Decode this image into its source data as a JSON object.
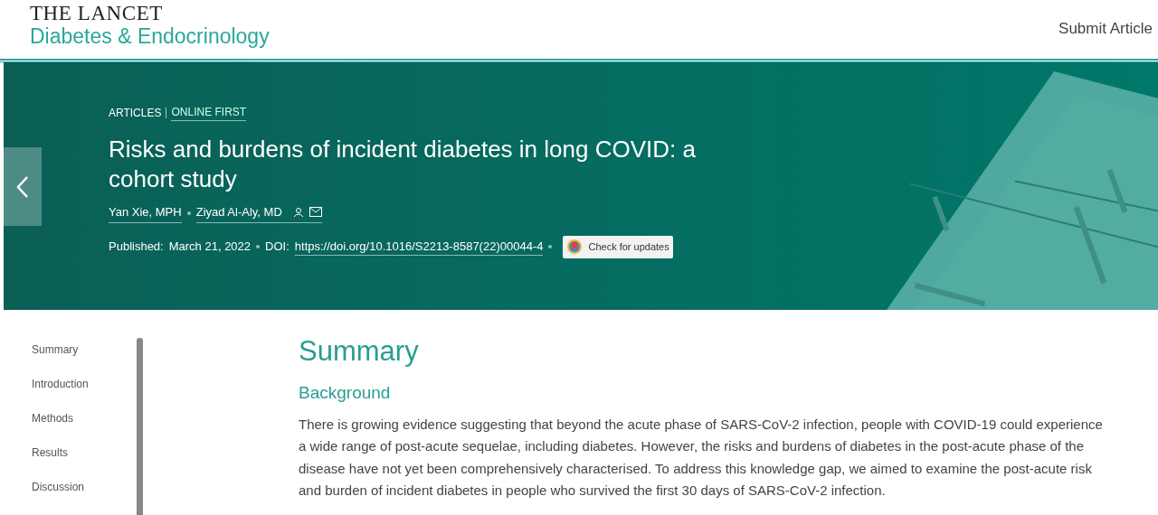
{
  "header": {
    "logo_top": "THE LANCET",
    "logo_bottom": "Diabetes & Endocrinology",
    "submit_link": "Submit Article"
  },
  "banner": {
    "category": "ARTICLES",
    "section": "ONLINE FIRST",
    "title": "Risks and burdens of incident diabetes in long COVID: a cohort study",
    "authors": [
      {
        "name": "Yan Xie, MPH",
        "contact": false
      },
      {
        "name": "Ziyad Al-Aly, MD",
        "contact": true
      }
    ],
    "published_label": "Published:",
    "published_date": "March 21, 2022",
    "doi_label": "DOI:",
    "doi": "https://doi.org/10.1016/S2213-8587(22)00044-4",
    "updates_button": "Check for updates"
  },
  "sidebar": {
    "items": [
      {
        "label": "Summary"
      },
      {
        "label": "Introduction"
      },
      {
        "label": "Methods"
      },
      {
        "label": "Results"
      },
      {
        "label": "Discussion"
      }
    ]
  },
  "article": {
    "heading": "Summary",
    "subheading": "Background",
    "paragraph": "There is growing evidence suggesting that beyond the acute phase of SARS-CoV-2 infection, people with COVID-19 could experience a wide range of post-acute sequelae, including diabetes. However, the risks and burdens of diabetes in the post-acute phase of the disease have not yet been comprehensively characterised. To address this knowledge gap, we aimed to examine the post-acute risk and burden of incident diabetes in people who survived the first 30 days of SARS-CoV-2 infection."
  }
}
